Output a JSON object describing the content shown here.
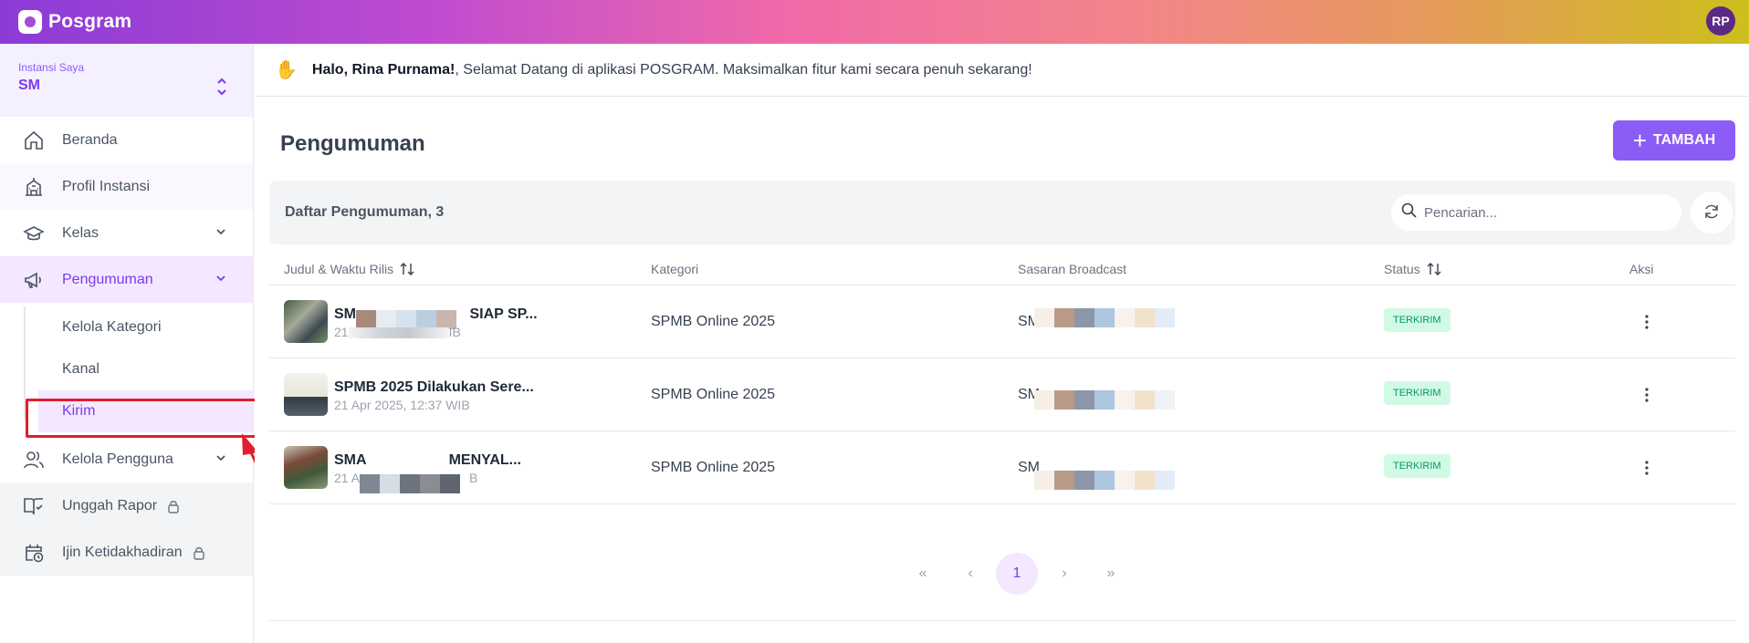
{
  "app": {
    "name": "Posgram",
    "user_initials": "RP"
  },
  "sidebar": {
    "instansi_label": "Instansi Saya",
    "instansi_name": "SM",
    "items": [
      {
        "label": "Beranda",
        "icon": "home-icon"
      },
      {
        "label": "Profil Instansi",
        "icon": "building-icon"
      },
      {
        "label": "Kelas",
        "icon": "graduation-cap-icon"
      },
      {
        "label": "Pengumuman",
        "icon": "megaphone-icon"
      },
      {
        "label": "Kelola Pengguna",
        "icon": "users-icon"
      },
      {
        "label": "Unggah Rapor",
        "icon": "book-check-icon"
      },
      {
        "label": "Ijin Ketidakhadiran",
        "icon": "calendar-clock-icon"
      }
    ],
    "sub_items": [
      {
        "label": "Kelola Kategori"
      },
      {
        "label": "Kanal"
      },
      {
        "label": "Kirim"
      }
    ]
  },
  "welcome": {
    "greeting": "Halo, Rina Purnama!",
    "message": ", Selamat Datang di aplikasi POSGRAM. Maksimalkan fitur kami secara penuh sekarang!"
  },
  "page": {
    "title": "Pengumuman",
    "add_button": "TAMBAH",
    "list_title": "Daftar Pengumuman, 3",
    "search_placeholder": "Pencarian..."
  },
  "table": {
    "columns": [
      "Judul & Waktu Rilis",
      "Kategori",
      "Sasaran Broadcast",
      "Status",
      "Aksi"
    ],
    "rows": [
      {
        "title_start": "SM",
        "title_end": "SIAP SP...",
        "time_start": "21",
        "time_end": "IB",
        "category": "SPMB Online 2025",
        "target": "SM",
        "status": "TERKIRIM"
      },
      {
        "title_start": "SPMB 2025 Dilakukan Sere...",
        "title_end": "",
        "time_start": "21 Apr 2025, 12:37 WIB",
        "time_end": "",
        "category": "SPMB Online 2025",
        "target": "SM",
        "status": "TERKIRIM"
      },
      {
        "title_start": "SMA",
        "title_end": "MENYAL...",
        "time_start": "21 A",
        "time_end": "B",
        "category": "SPMB Online 2025",
        "target": "SM",
        "status": "TERKIRIM"
      }
    ]
  },
  "pagination": {
    "first": "«",
    "prev": "‹",
    "current": "1",
    "next": "›",
    "last": "»"
  },
  "colors": {
    "accent": "#8b5cf6",
    "active_text": "#7c3aed",
    "highlight": "#e11d2e",
    "status_bg": "#d1fae5",
    "status_text": "#059669"
  }
}
